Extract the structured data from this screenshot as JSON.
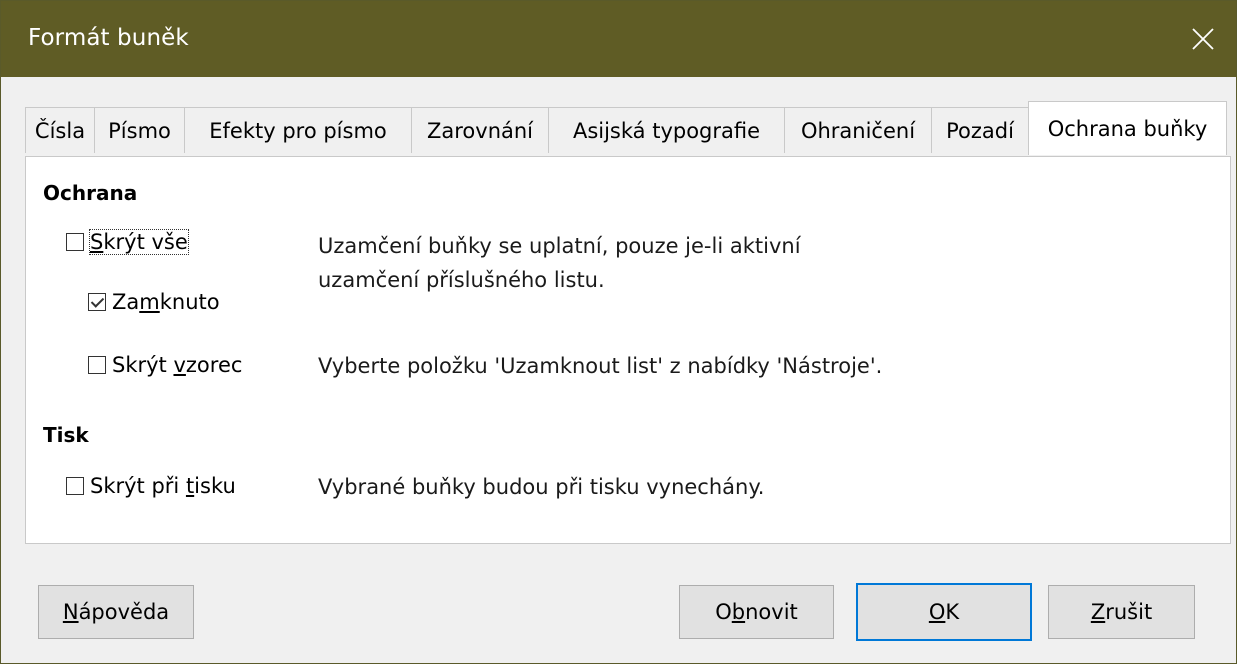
{
  "window": {
    "title": "Formát buněk"
  },
  "tabs": [
    {
      "label": "Čísla"
    },
    {
      "label": "Písmo"
    },
    {
      "label": "Efekty pro písmo"
    },
    {
      "label": "Zarovnání"
    },
    {
      "label": "Asijská typografie"
    },
    {
      "label": "Ohraničení"
    },
    {
      "label": "Pozadí"
    },
    {
      "label": "Ochrana buňky"
    }
  ],
  "protection": {
    "heading": "Ochrana",
    "hide_all": {
      "label_pre": "",
      "label_u": "S",
      "label_post": "krýt vše",
      "checked": false
    },
    "locked": {
      "label_pre": "Za",
      "label_u": "m",
      "label_post": "knuto",
      "checked": true
    },
    "hide_formula": {
      "label_pre": "Skrýt ",
      "label_u": "v",
      "label_post": "zorec",
      "checked": false
    },
    "desc1_line1": "Uzamčení buňky se uplatní, pouze je-li aktivní",
    "desc1_line2": "uzamčení příslušného listu.",
    "desc2": "Vyberte položku 'Uzamknout list' z nabídky 'Nástroje'."
  },
  "print": {
    "heading": "Tisk",
    "hide_print": {
      "label_pre": "Skrýt při ",
      "label_u": "t",
      "label_post": "isku",
      "checked": false
    },
    "desc": "Vybrané buňky budou při tisku vynechány."
  },
  "buttons": {
    "help": {
      "u": "N",
      "rest": "ápověda"
    },
    "reset": {
      "pre": "O",
      "u": "b",
      "rest": "novit"
    },
    "ok": {
      "u": "O",
      "rest": "K"
    },
    "cancel": {
      "u": "Z",
      "rest": "rušit"
    }
  },
  "colors": {
    "titlebar": "#5f5c25",
    "default_button_border": "#0078d7"
  }
}
